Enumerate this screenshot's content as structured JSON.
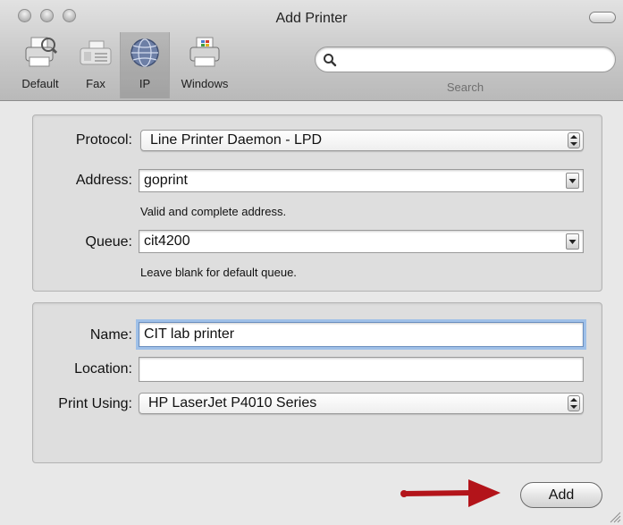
{
  "window": {
    "title": "Add Printer"
  },
  "toolbar": {
    "items": [
      {
        "label": "Default",
        "icon": "printer-icon"
      },
      {
        "label": "Fax",
        "icon": "fax-icon"
      },
      {
        "label": "IP",
        "icon": "globe-icon",
        "selected": true
      },
      {
        "label": "Windows",
        "icon": "windows-printer-icon"
      }
    ],
    "search": {
      "placeholder": "",
      "value": "",
      "caption": "Search"
    }
  },
  "connection": {
    "protocol": {
      "label": "Protocol:",
      "value": "Line Printer Daemon - LPD"
    },
    "address": {
      "label": "Address:",
      "value": "goprint",
      "hint": "Valid and complete address."
    },
    "queue": {
      "label": "Queue:",
      "value": "cit4200",
      "hint": "Leave blank for default queue."
    }
  },
  "details": {
    "name": {
      "label": "Name:",
      "value": "CIT lab printer"
    },
    "location": {
      "label": "Location:",
      "value": ""
    },
    "print_using": {
      "label": "Print Using:",
      "value": "HP LaserJet P4010 Series"
    }
  },
  "footer": {
    "add_label": "Add",
    "arrow_color": "#b3141a"
  },
  "colors": {
    "window_bg": "#e8e8e8",
    "group_bg": "#dedede",
    "focus_ring": "#9fc0e8"
  }
}
